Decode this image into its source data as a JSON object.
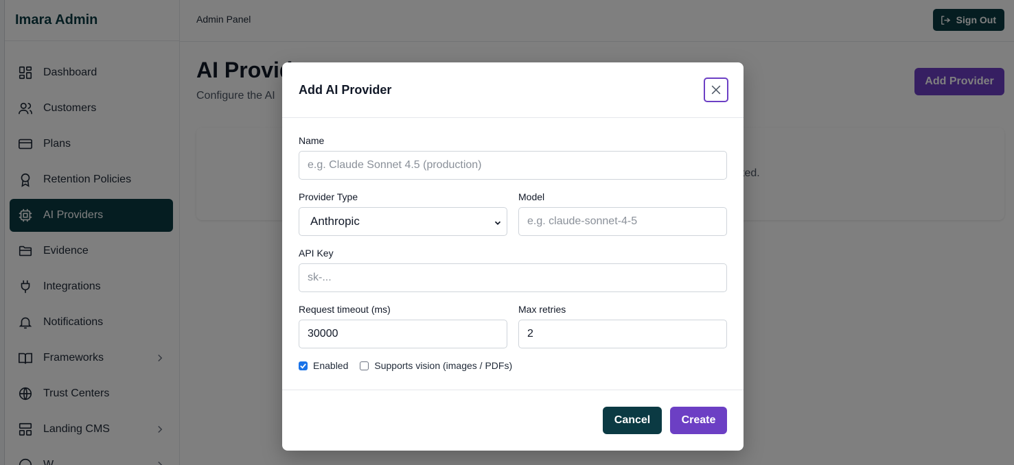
{
  "app": {
    "brand": "Imara Admin"
  },
  "header": {
    "breadcrumb": "Admin Panel",
    "sign_out_label": "Sign Out"
  },
  "sidebar": {
    "items": [
      {
        "label": "Dashboard",
        "icon": "dashboard-icon",
        "active": false,
        "has_children": false
      },
      {
        "label": "Customers",
        "icon": "users-icon",
        "active": false,
        "has_children": false
      },
      {
        "label": "Plans",
        "icon": "credit-card-icon",
        "active": false,
        "has_children": false
      },
      {
        "label": "Retention Policies",
        "icon": "badge-icon",
        "active": false,
        "has_children": false
      },
      {
        "label": "AI Providers",
        "icon": "cpu-icon",
        "active": true,
        "has_children": false
      },
      {
        "label": "Evidence",
        "icon": "folder-icon",
        "active": false,
        "has_children": false
      },
      {
        "label": "Integrations",
        "icon": "plug-icon",
        "active": false,
        "has_children": false
      },
      {
        "label": "Notifications",
        "icon": "bell-icon",
        "active": false,
        "has_children": false
      },
      {
        "label": "Frameworks",
        "icon": "book-icon",
        "active": false,
        "has_children": true
      },
      {
        "label": "Trust Centers",
        "icon": "globe-icon",
        "active": false,
        "has_children": false
      },
      {
        "label": "Landing CMS",
        "icon": "layout-icon",
        "active": false,
        "has_children": true
      },
      {
        "label": "W",
        "icon": "generic-icon",
        "active": false,
        "has_children": true
      }
    ]
  },
  "main": {
    "title": "AI Provid",
    "subtitle": "Configure the AI",
    "add_provider_label": "Add Provider",
    "empty_state_fragment": "ted."
  },
  "modal": {
    "title": "Add AI Provider",
    "name": {
      "label": "Name",
      "placeholder": "e.g. Claude Sonnet 4.5 (production)",
      "value": ""
    },
    "provider_type": {
      "label": "Provider Type",
      "selected": "Anthropic"
    },
    "model": {
      "label": "Model",
      "placeholder": "e.g. claude-sonnet-4-5",
      "value": ""
    },
    "api_key": {
      "label": "API Key",
      "placeholder": "sk-...",
      "value": ""
    },
    "request_timeout": {
      "label": "Request timeout (ms)",
      "value": "30000"
    },
    "max_retries": {
      "label": "Max retries",
      "value": "2"
    },
    "enabled": {
      "label": "Enabled",
      "checked": true
    },
    "supports_vision": {
      "label": "Supports vision (images / PDFs)",
      "checked": false
    },
    "cancel_label": "Cancel",
    "create_label": "Create"
  },
  "colors": {
    "brand_dark": "#0b3a43",
    "accent_purple": "#6c3fc4",
    "checkbox_blue": "#1a73e8"
  }
}
